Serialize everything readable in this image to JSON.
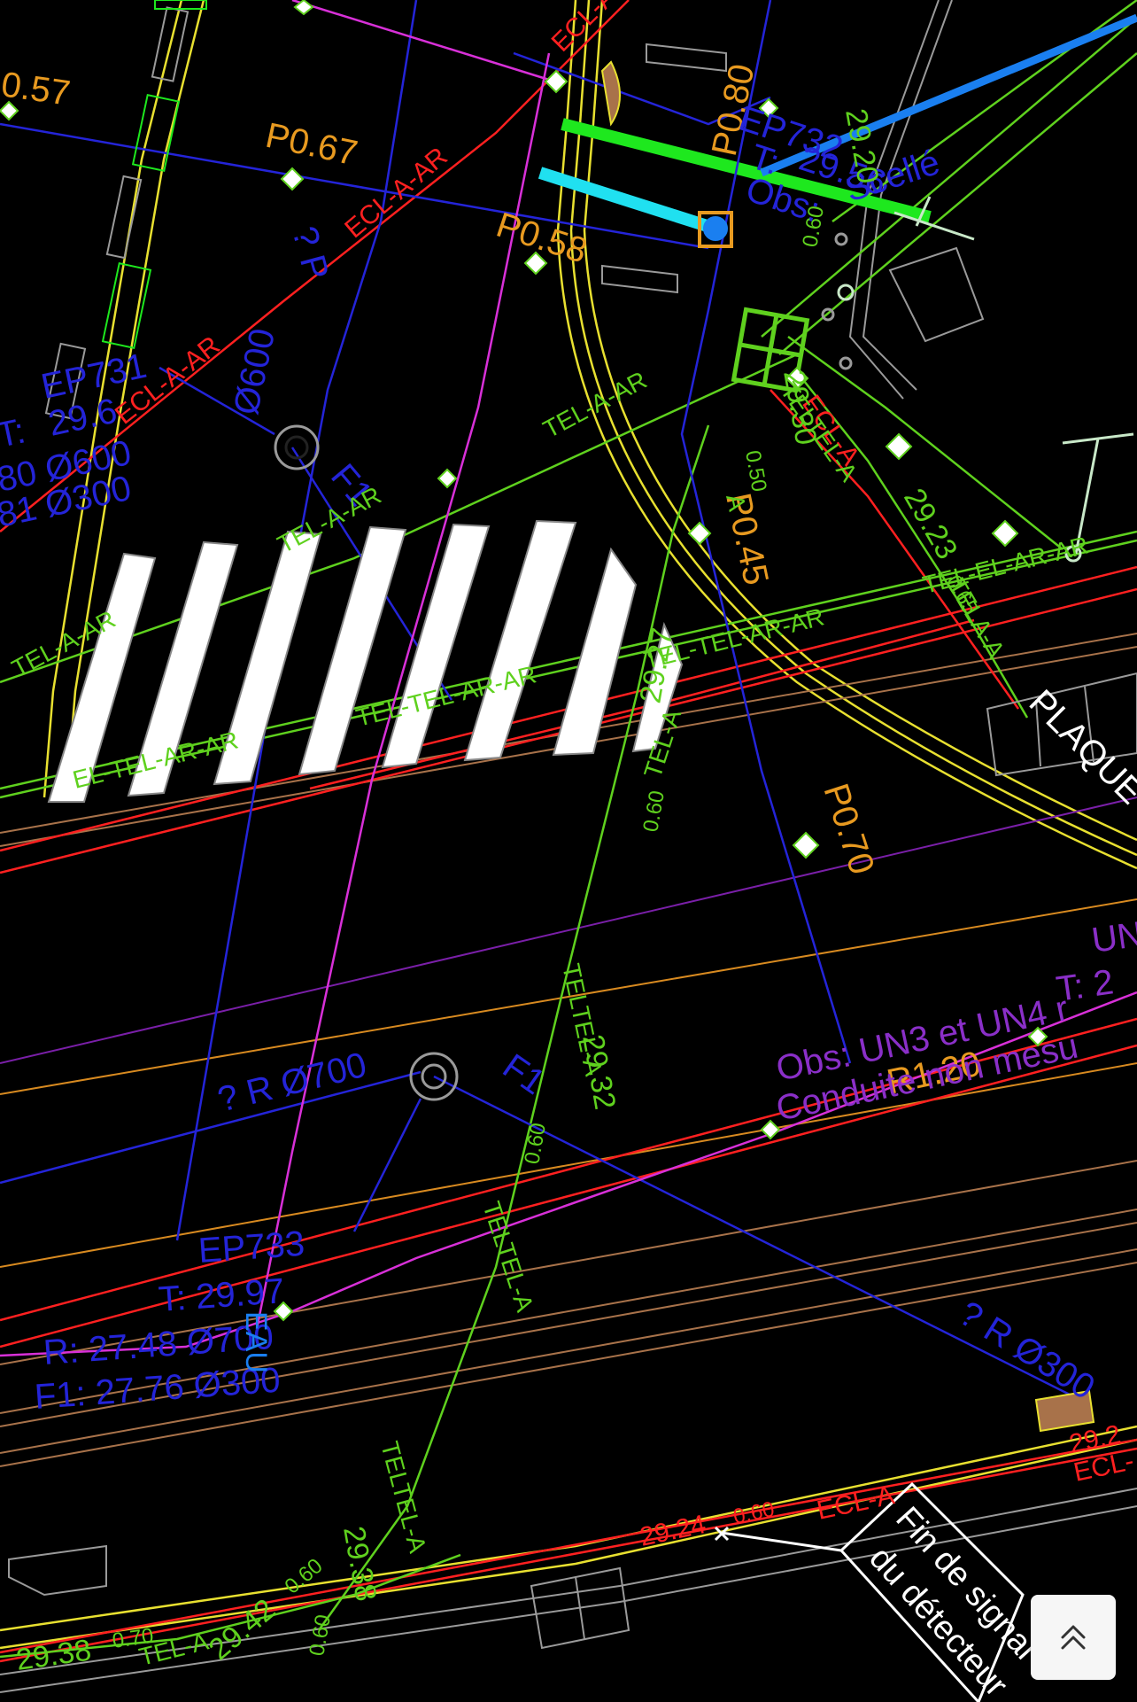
{
  "plan": {
    "labels": {
      "p057": "0.57",
      "p067": "P0.67",
      "p058": "P0.58",
      "p080": "P0.80",
      "p045": "P0.45",
      "p070": "P0.70",
      "r120": "R1.20",
      "ep731": "EP731",
      "ep731_t": "T:",
      "ep731_v1": "29.6",
      "ep731_v2": "80  Ø600",
      "ep731_v3": "81  Ø300",
      "ep732": "EP732",
      "ep732_t": "T:",
      "ep732_v": "29.56",
      "ep732_obs": "Obs:",
      "ep732_scelle": "Scellé",
      "q_p": "? P",
      "d600": "Ø600",
      "f1_a": "F1",
      "f1_b": "F1",
      "r700": "? R Ø700",
      "r300": "? R Ø300",
      "ep733": "EP733",
      "ep733_t": "T:  29.97",
      "ep733_r": "R:  27.48  Ø700",
      "ep733_f1": "F1:  27.76  Ø300",
      "eau": "EAU",
      "un": "UN",
      "un_t": "T:  2",
      "obs_un": "Obs:  UN3 et UN4 r",
      "conduite": "Conduite non mesu",
      "plaque": "PLAQUE",
      "fin_1": "Fin de signal",
      "fin_2": "du détecteur",
      "ecl_a_ar_1": "ECL-A-AR",
      "ecl_a_ar_2": "ECL-A-AR",
      "ecl_a_ar_3": "ECL-A-AR",
      "ecl_a_ar_4": "ECL-A",
      "ecl_bottom": "ECL-A",
      "tel_a_ar_1": "TEL-A-AR",
      "tel_a_ar_2": "TEL-A-AR",
      "tel_a_ar_3": "TEL-A-AR",
      "tel_cross": "EL-TEL-AR-AR",
      "tel_mid": "TEL-TEL-AR-AR",
      "tel_right": "TEL-TEL-AR-AR",
      "tel_rr": "TEL-EL-AR-AR",
      "telta_1": "TELTEL-A",
      "telta_2": "TELTEL-A",
      "telta_3": "TELTEL-A",
      "telta_4": "TEL-A",
      "telta_5": "TELTEL-A",
      "telta_6": "TELA-A",
      "v2920": "29.20",
      "v060a": "0.60",
      "v2930": "29.30",
      "v050": "0.50",
      "v2923": "29.23",
      "v065": "0.65",
      "v2927": "29.27",
      "v060b": "0.60",
      "v2932": "29.32",
      "v060c": "0.60",
      "v2924": "29.24",
      "v060d": "0.60",
      "v2938a": "29.38",
      "v060e": "0.60",
      "v2942": "29.42",
      "v060f": "0.60",
      "v2938b": "29.38",
      "v070": "0.70",
      "v292": "29.2",
      "ecl_r": "ECL-",
      "a_lbl": "A",
      "tel_a_lbl": "TEL-A"
    },
    "colors": {
      "background": "#000000",
      "telecom": "#5fd11e",
      "lighting": "#ff2020",
      "water": "#2424d8",
      "gas": "#d830d8",
      "curb": "#e8e030",
      "depth_label": "#e89a20",
      "fiber": "#1a7ff0",
      "cyan": "#20e0f0",
      "brown": "#a8724a",
      "purple": "#7a1fa8"
    },
    "icons": [
      "manhole-icon",
      "survey-point-icon",
      "chevron-up-icon"
    ]
  },
  "controls": {
    "scroll_top_label": "Scroll to top"
  }
}
